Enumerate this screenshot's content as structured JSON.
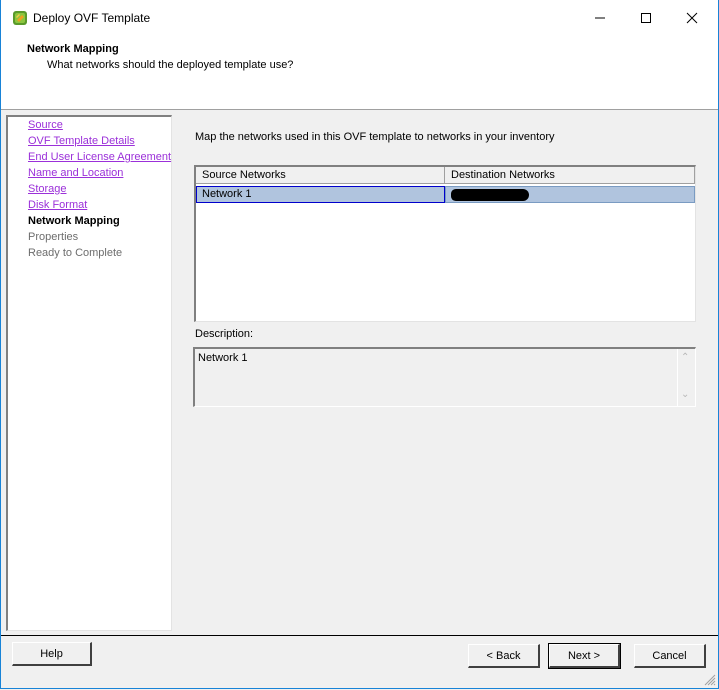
{
  "window": {
    "title": "Deploy OVF Template",
    "controls": {
      "minimize": "minimize",
      "maximize": "maximize",
      "close": "close"
    }
  },
  "header": {
    "title": "Network Mapping",
    "subtitle": "What networks should the deployed template use?"
  },
  "nav": {
    "items": [
      {
        "label": "Source",
        "state": "completed"
      },
      {
        "label": "OVF Template Details",
        "state": "completed"
      },
      {
        "label": "End User License Agreement",
        "state": "completed"
      },
      {
        "label": "Name and Location",
        "state": "completed"
      },
      {
        "label": "Storage",
        "state": "completed"
      },
      {
        "label": "Disk Format",
        "state": "completed"
      },
      {
        "label": "Network Mapping",
        "state": "current"
      },
      {
        "label": "Properties",
        "state": "pending"
      },
      {
        "label": "Ready to Complete",
        "state": "pending"
      }
    ]
  },
  "main": {
    "intro": "Map the networks used in this OVF template to networks in your inventory",
    "table": {
      "columns": [
        "Source Networks",
        "Destination Networks"
      ],
      "rows": [
        {
          "source": "Network 1",
          "destination": "[redacted]"
        }
      ]
    },
    "description_label": "Description:",
    "description_text": "Network 1"
  },
  "footer": {
    "help": "Help",
    "back": "< Back",
    "next": "Next >",
    "cancel": "Cancel"
  },
  "colors": {
    "link": "#9b30d9",
    "selection": "#b0c4de",
    "window_border": "#1883d7"
  }
}
